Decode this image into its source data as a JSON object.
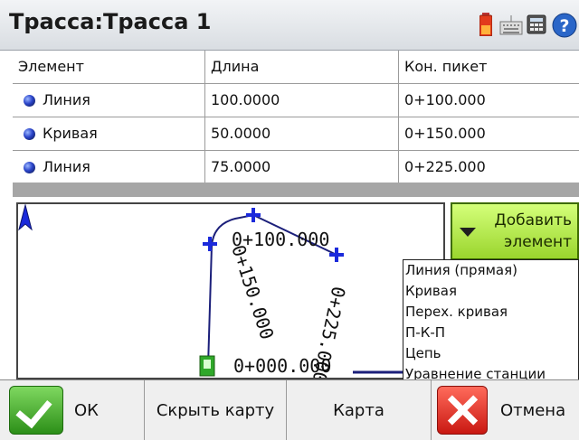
{
  "title": "Трасса:Трасса 1",
  "title_icons": [
    "battery-icon",
    "keyboard-icon",
    "calculator-icon",
    "help-icon"
  ],
  "table": {
    "columns": [
      "Элемент",
      "Длина",
      "Кон. пикет"
    ],
    "rows": [
      {
        "element": "Линия",
        "length": "100.0000",
        "end_station": "0+100.000"
      },
      {
        "element": "Кривая",
        "length": "50.0000",
        "end_station": "0+150.000"
      },
      {
        "element": "Линия",
        "length": "75.0000",
        "end_station": "0+225.000"
      }
    ]
  },
  "map": {
    "labels": {
      "top": "0+100.000",
      "left": "0+150.000",
      "right": "0+225.000",
      "bottom": "0+000.000"
    },
    "north_icon": "north-arrow-icon"
  },
  "add_button": {
    "line1": "Добавить",
    "line2": "элемент"
  },
  "menu": {
    "items": [
      "Линия (прямая)",
      "Кривая",
      "Перех. кривая",
      "П-К-П",
      "Цепь",
      "Уравнение станции"
    ]
  },
  "toolbar": {
    "ok": "ОК",
    "hide_map": "Скрыть карту",
    "map": "Карта",
    "cancel": "Отмена"
  },
  "colors": {
    "add_button": "#b4ec4c",
    "ok_icon": "#3fa82a",
    "cancel_icon": "#e0241b",
    "alignment_line": "#1b1f7a"
  }
}
